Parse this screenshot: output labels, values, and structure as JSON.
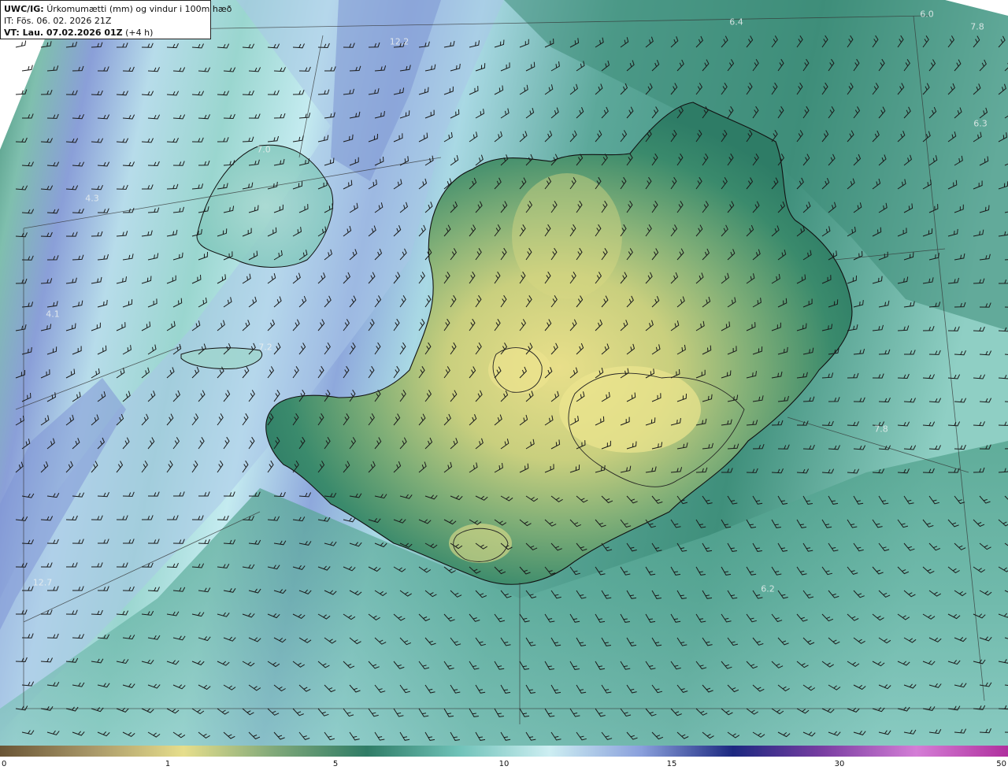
{
  "header": {
    "model": "UWC/IG:",
    "title": "Úrkomumætti (mm) og vindur i 100m hæð",
    "init_time": "IT: Fös. 06. 02. 2026 21Z",
    "valid_prefix": "VT: Lau. 07.02.2026 01Z",
    "valid_suffix": "(+4 h)"
  },
  "colors": {
    "low": "#6e5a3a",
    "yellow": "#e8e08a",
    "green": "#2e7e64",
    "teal": "#7ec9c0",
    "pale": "#c8ecf0",
    "blue": "#7f94d6",
    "navy": "#1e2a80",
    "magenta": "#c060c0"
  },
  "colorbar": {
    "ticks": [
      "0",
      "1",
      "5",
      "10",
      "15",
      "30",
      "50"
    ],
    "segments": [
      {
        "value": 0,
        "color": "#6a5535"
      },
      {
        "value": 0.5,
        "color": "#a89768"
      },
      {
        "value": 1,
        "color": "#e6de8c"
      },
      {
        "value": 3,
        "color": "#7fa879"
      },
      {
        "value": 5,
        "color": "#2f7c66"
      },
      {
        "value": 7.5,
        "color": "#6fc2b8"
      },
      {
        "value": 10,
        "color": "#cdeef2"
      },
      {
        "value": 12.5,
        "color": "#8aa0dc"
      },
      {
        "value": 15,
        "color": "#1c2880"
      },
      {
        "value": 22,
        "color": "#7b3fa3"
      },
      {
        "value": 30,
        "color": "#d47ed6"
      },
      {
        "value": 50,
        "color": "#b0309e"
      }
    ]
  },
  "value_labels": [
    {
      "text": "12.2",
      "slot": "a"
    },
    {
      "text": "6.4",
      "slot": "b"
    },
    {
      "text": "6.0",
      "slot": "c"
    },
    {
      "text": "7.8",
      "slot": "d"
    },
    {
      "text": "6.3",
      "slot": "e"
    },
    {
      "text": "7.0",
      "slot": "f"
    },
    {
      "text": "4.3",
      "slot": "g"
    },
    {
      "text": "4.1",
      "slot": "h"
    },
    {
      "text": "7.2",
      "slot": "i"
    },
    {
      "text": "7.8",
      "slot": "j"
    },
    {
      "text": "12.7",
      "slot": "k"
    },
    {
      "text": "6.2",
      "slot": "l"
    }
  ]
}
